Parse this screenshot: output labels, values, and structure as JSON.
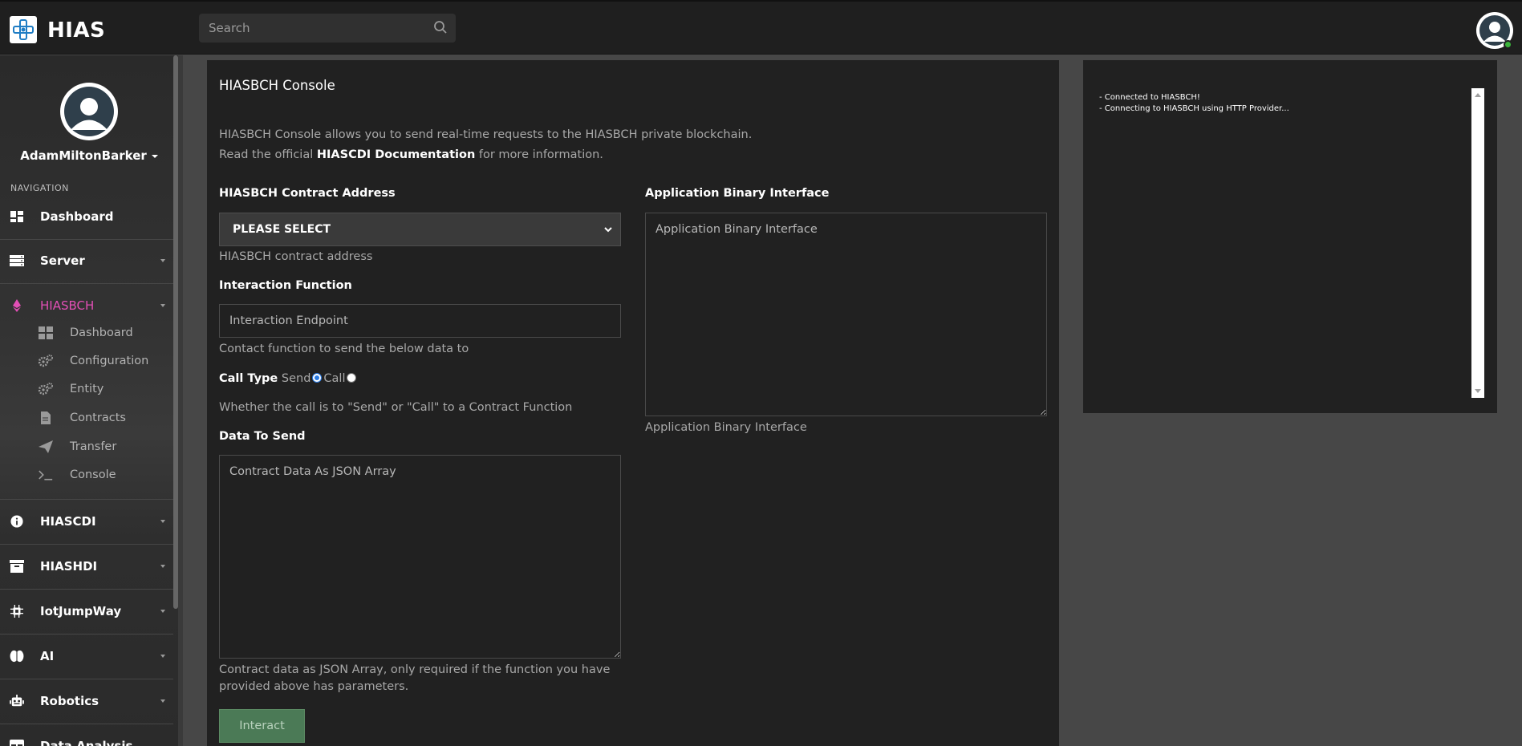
{
  "header": {
    "brand": "HIAS",
    "search_placeholder": "Search"
  },
  "profile": {
    "username": "AdamMiltonBarker"
  },
  "sidebar": {
    "heading": "NAVIGATION",
    "items": [
      {
        "label": "Dashboard",
        "icon": "dashboard-icon",
        "expandable": false
      },
      {
        "label": "Server",
        "icon": "server-icon",
        "expandable": true
      },
      {
        "label": "HIASBCH",
        "icon": "ethereum-icon",
        "expandable": true,
        "active": true,
        "subitems": [
          {
            "label": "Dashboard",
            "icon": "grid-icon"
          },
          {
            "label": "Configuration",
            "icon": "cogs-icon"
          },
          {
            "label": "Entity",
            "icon": "cogs-icon"
          },
          {
            "label": "Contracts",
            "icon": "file-contract-icon"
          },
          {
            "label": "Transfer",
            "icon": "paper-plane-icon"
          },
          {
            "label": "Console",
            "icon": "terminal-icon"
          }
        ]
      },
      {
        "label": "HIASCDI",
        "icon": "info-circle-icon",
        "expandable": true
      },
      {
        "label": "HIASHDI",
        "icon": "archive-icon",
        "expandable": true
      },
      {
        "label": "IotJumpWay",
        "icon": "chip-icon",
        "expandable": true
      },
      {
        "label": "AI",
        "icon": "brain-icon",
        "expandable": true
      },
      {
        "label": "Robotics",
        "icon": "robot-icon",
        "expandable": true
      },
      {
        "label": "Data Analysis",
        "icon": "table-icon",
        "expandable": true
      }
    ]
  },
  "main": {
    "title": "HIASBCH Console",
    "description_line1": "HIASBCH Console allows you to send real-time requests to the HIASBCH private blockchain.",
    "description_line2_prefix": "Read the official ",
    "description_link": "HIASCDI Documentation",
    "description_line2_suffix": " for more information.",
    "contract_address": {
      "label": "HIASBCH Contract Address",
      "selected": "PLEASE SELECT",
      "help": "HIASBCH contract address"
    },
    "interaction_function": {
      "label": "Interaction Function",
      "placeholder": "Interaction Endpoint",
      "help": "Contact function to send the below data to"
    },
    "call_type": {
      "label": "Call Type",
      "option_send": "Send",
      "option_call": "Call",
      "selected": "Send",
      "help": "Whether the call is to \"Send\" or \"Call\" to a Contract Function"
    },
    "data_to_send": {
      "label": "Data To Send",
      "placeholder": "Contract Data As JSON Array",
      "help_line1": "Contract data as JSON Array, only required if the function you have",
      "help_line2": "provided above has parameters."
    },
    "abi": {
      "label": "Application Binary Interface",
      "placeholder": "Application Binary Interface",
      "help": "Application Binary Interface"
    },
    "submit_label": "Interact"
  },
  "console": {
    "lines": [
      "- Connected to HIASBCH!",
      "- Connecting to HIASBCH using HTTP Provider..."
    ]
  },
  "colors": {
    "active_nav": "#e34fb6",
    "submit_button": "#4b7a56",
    "radio_selected": "#2a7ae2"
  }
}
